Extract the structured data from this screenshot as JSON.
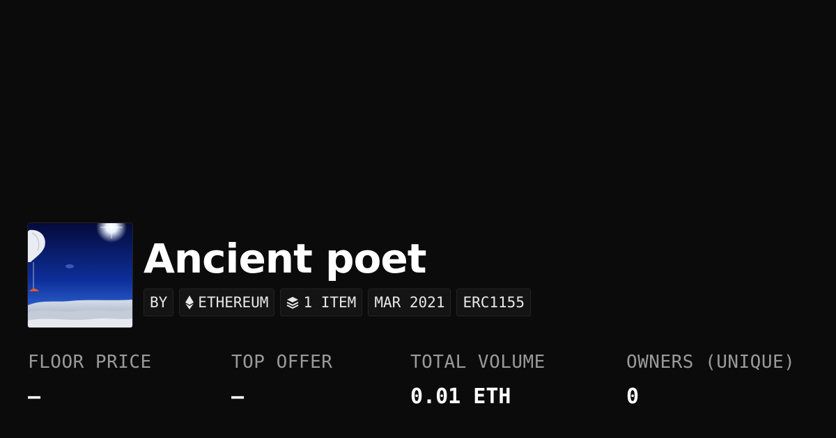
{
  "collection": {
    "title": "Ancient poet",
    "image_icon": "balloon-over-clouds-image"
  },
  "chips": {
    "by_label": "BY",
    "chain_label": "ETHEREUM",
    "chain_icon": "ethereum-icon",
    "items_label": "1 ITEM",
    "items_icon": "layers-icon",
    "date_label": "MAR 2021",
    "standard_label": "ERC1155"
  },
  "stats": {
    "floor_price": {
      "label": "FLOOR PRICE",
      "value": "–"
    },
    "top_offer": {
      "label": "TOP OFFER",
      "value": "–"
    },
    "total_volume": {
      "label": "TOTAL VOLUME",
      "value": "0.01 ETH"
    },
    "owners": {
      "label": "OWNERS (UNIQUE)",
      "value": "0"
    }
  },
  "colors": {
    "background": "#0b0b0b",
    "chip_background": "#141414",
    "label_gray": "#9a9a9a",
    "text_white": "#ffffff"
  }
}
